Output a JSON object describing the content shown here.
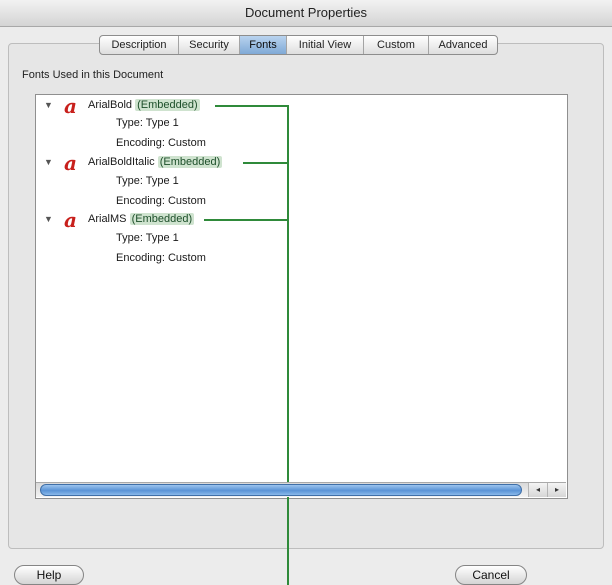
{
  "window": {
    "title": "Document Properties"
  },
  "tabs": [
    {
      "label": "Description"
    },
    {
      "label": "Security"
    },
    {
      "label": "Fonts"
    },
    {
      "label": "Initial View"
    },
    {
      "label": "Custom"
    },
    {
      "label": "Advanced"
    }
  ],
  "active_tab": "Fonts",
  "section_label": "Fonts Used in this Document",
  "fonts": [
    {
      "name": "ArialBold",
      "status": "(Embedded)",
      "type": "Type: Type 1",
      "encoding": "Encoding: Custom"
    },
    {
      "name": "ArialBoldItalic",
      "status": "(Embedded)",
      "type": "Type: Type 1",
      "encoding": "Encoding: Custom"
    },
    {
      "name": "ArialMS",
      "status": "(Embedded)",
      "type": "Type: Type 1",
      "encoding": "Encoding: Custom"
    }
  ],
  "font_icon_glyph": "a",
  "disclosure_glyph": "▼",
  "scroll_left_glyph": "◂",
  "scroll_right_glyph": "▸",
  "buttons": {
    "help": "Help",
    "cancel": "Cancel"
  },
  "colors": {
    "accent": "#2f8a3a",
    "icon": "#c8201c",
    "selected_tab": "#7fa9d6"
  }
}
